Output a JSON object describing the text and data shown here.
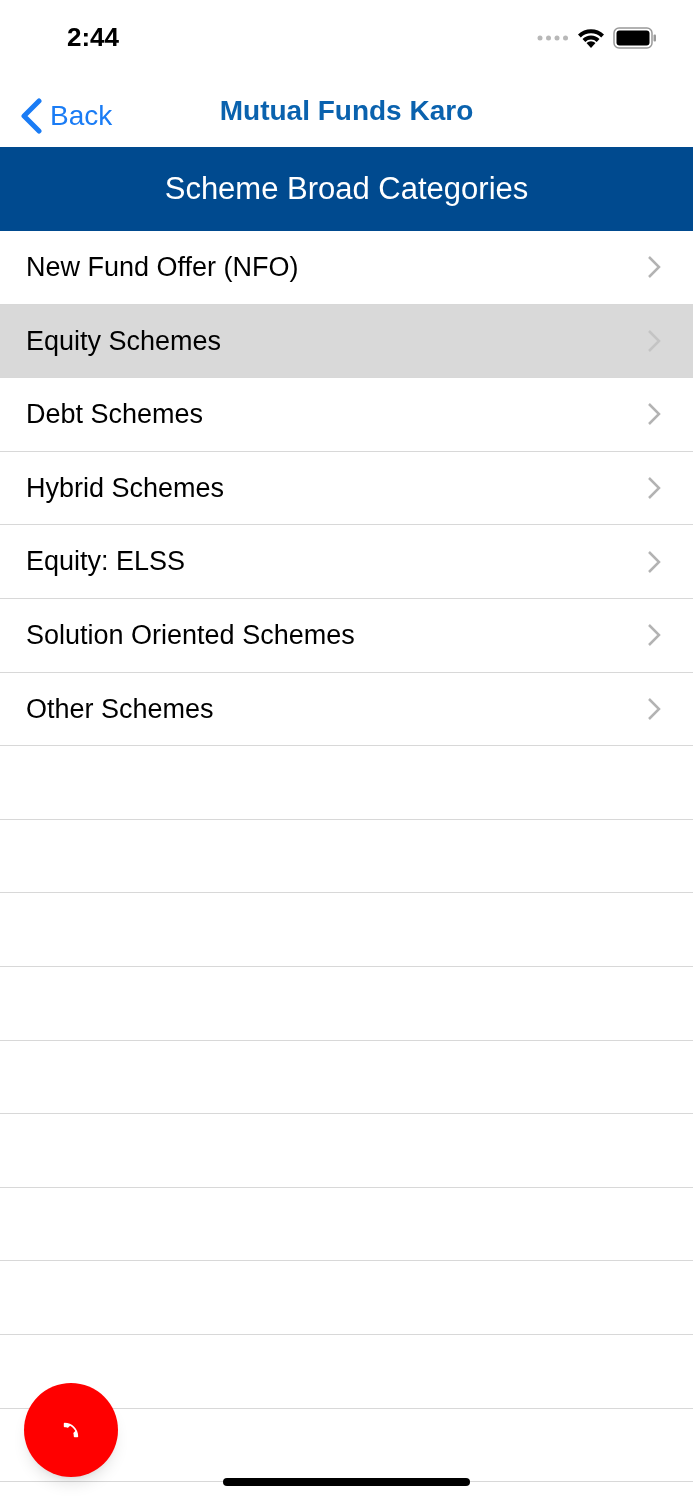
{
  "status_bar": {
    "time": "2:44"
  },
  "nav_bar": {
    "back": "Back",
    "title": "Mutual Funds Karo"
  },
  "header": {
    "title": "Scheme Broad Categories"
  },
  "categories": [
    {
      "label": "New Fund Offer (NFO)",
      "selected": false
    },
    {
      "label": "Equity Schemes",
      "selected": true
    },
    {
      "label": "Debt Schemes",
      "selected": false
    },
    {
      "label": "Hybrid Schemes",
      "selected": false
    },
    {
      "label": "Equity: ELSS",
      "selected": false
    },
    {
      "label": "Solution Oriented Schemes",
      "selected": false
    },
    {
      "label": "Other Schemes",
      "selected": false
    }
  ]
}
